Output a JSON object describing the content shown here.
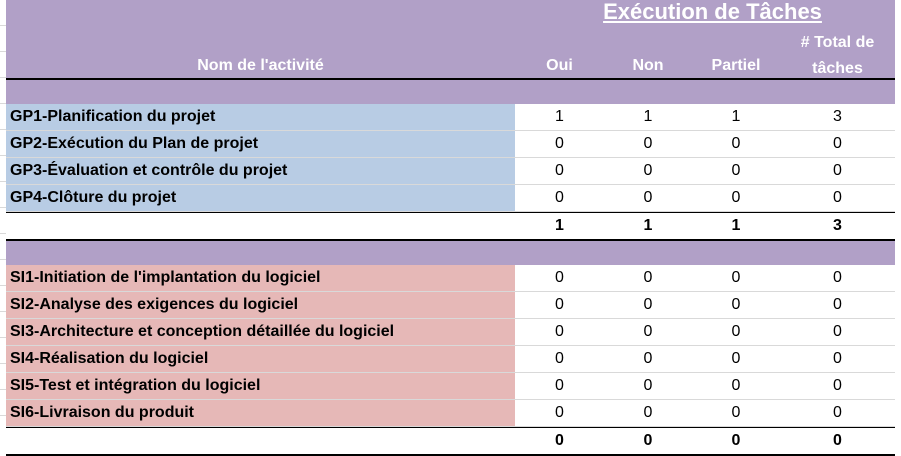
{
  "header": {
    "title": "Exécution de Tâches",
    "col_name": "Nom de l'activité",
    "col_oui": "Oui",
    "col_non": "Non",
    "col_partiel": "Partiel",
    "col_total_line1": "# Total de",
    "col_total_line2": "tâches"
  },
  "gp_rows": [
    {
      "name": "GP1-Planification du projet",
      "oui": "1",
      "non": "1",
      "partiel": "1",
      "total": "3"
    },
    {
      "name": "GP2-Exécution du Plan de projet",
      "oui": "0",
      "non": "0",
      "partiel": "0",
      "total": "0"
    },
    {
      "name": "GP3-Évaluation et contrôle du projet",
      "oui": "0",
      "non": "0",
      "partiel": "0",
      "total": "0"
    },
    {
      "name": "GP4-Clôture du projet",
      "oui": "0",
      "non": "0",
      "partiel": "0",
      "total": "0"
    }
  ],
  "gp_total": {
    "oui": "1",
    "non": "1",
    "partiel": "1",
    "total": "3"
  },
  "si_rows": [
    {
      "name": "SI1-Initiation de l'implantation du logiciel",
      "oui": "0",
      "non": "0",
      "partiel": "0",
      "total": "0"
    },
    {
      "name": "SI2-Analyse des exigences du logiciel",
      "oui": "0",
      "non": "0",
      "partiel": "0",
      "total": "0"
    },
    {
      "name": "SI3-Architecture et conception détaillée du logiciel",
      "oui": "0",
      "non": "0",
      "partiel": "0",
      "total": "0"
    },
    {
      "name": "SI4-Réalisation du logiciel",
      "oui": "0",
      "non": "0",
      "partiel": "0",
      "total": "0"
    },
    {
      "name": "SI5-Test et intégration du logiciel",
      "oui": "0",
      "non": "0",
      "partiel": "0",
      "total": "0"
    },
    {
      "name": "SI6-Livraison du produit",
      "oui": "0",
      "non": "0",
      "partiel": "0",
      "total": "0"
    }
  ],
  "si_total": {
    "oui": "0",
    "non": "0",
    "partiel": "0",
    "total": "0"
  },
  "colors": {
    "header_bg": "#b1a0c7",
    "gp_bg": "#b8cce4",
    "si_bg": "#e6b8b7"
  }
}
